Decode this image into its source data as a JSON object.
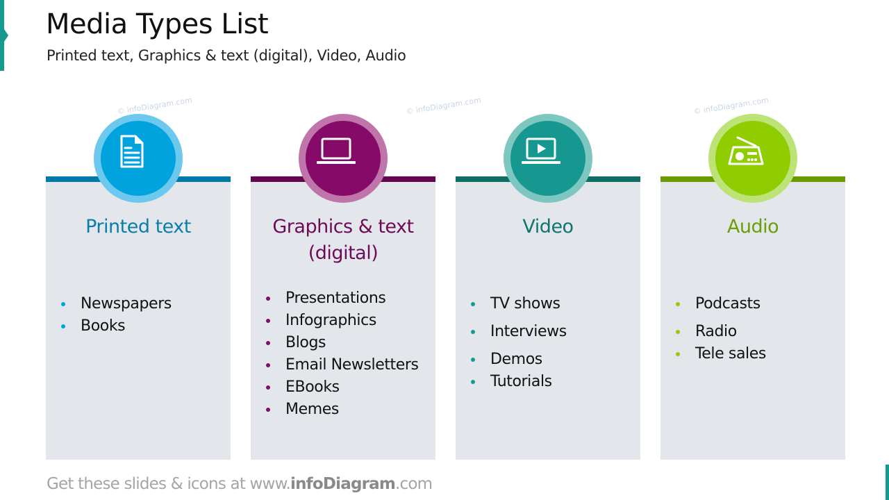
{
  "header": {
    "title": "Media Types List",
    "subtitle": "Printed text, Graphics & text (digital), Video, Audio"
  },
  "watermark": "© infoDiagram.com",
  "cards": [
    {
      "title": "Printed text",
      "icon": "document-icon",
      "colors": {
        "bar": "#0079a8",
        "circle": "#00a3de",
        "ring": "#6cc8ec",
        "title": "#0b7ea8",
        "bullet": "#00a3de"
      },
      "items": [
        "Newspapers",
        "Books"
      ]
    },
    {
      "title": "Graphics & text (digital)",
      "title_line1": "Graphics & text",
      "title_line2": "(digital)",
      "icon": "laptop-icon",
      "colors": {
        "bar": "#63054f",
        "circle": "#860a68",
        "ring": "#bf75a9",
        "title": "#6e0a58",
        "bullet": "#860a68"
      },
      "items": [
        "Presentations",
        "Infographics",
        "Blogs",
        "Email Newsletters",
        "EBooks",
        "Memes"
      ]
    },
    {
      "title": "Video",
      "icon": "video-laptop-icon",
      "colors": {
        "bar": "#0f6d66",
        "circle": "#169890",
        "ring": "#7ec7c1",
        "title": "#10756d",
        "bullet": "#169890"
      },
      "items": [
        "TV shows",
        "Interviews",
        "Demos",
        "Tutorials"
      ]
    },
    {
      "title": "Audio",
      "icon": "radio-icon",
      "colors": {
        "bar": "#6a9b00",
        "circle": "#8fcc00",
        "ring": "#bde377",
        "title": "#6a9f0a",
        "bullet": "#8fcc00"
      },
      "items": [
        "Podcasts",
        "Radio",
        "Tele sales"
      ]
    }
  ],
  "footer": {
    "prefix": "Get these slides & icons at www.",
    "brand": "infoDiagram",
    "suffix": ".com"
  },
  "accent_color": "#16998f"
}
